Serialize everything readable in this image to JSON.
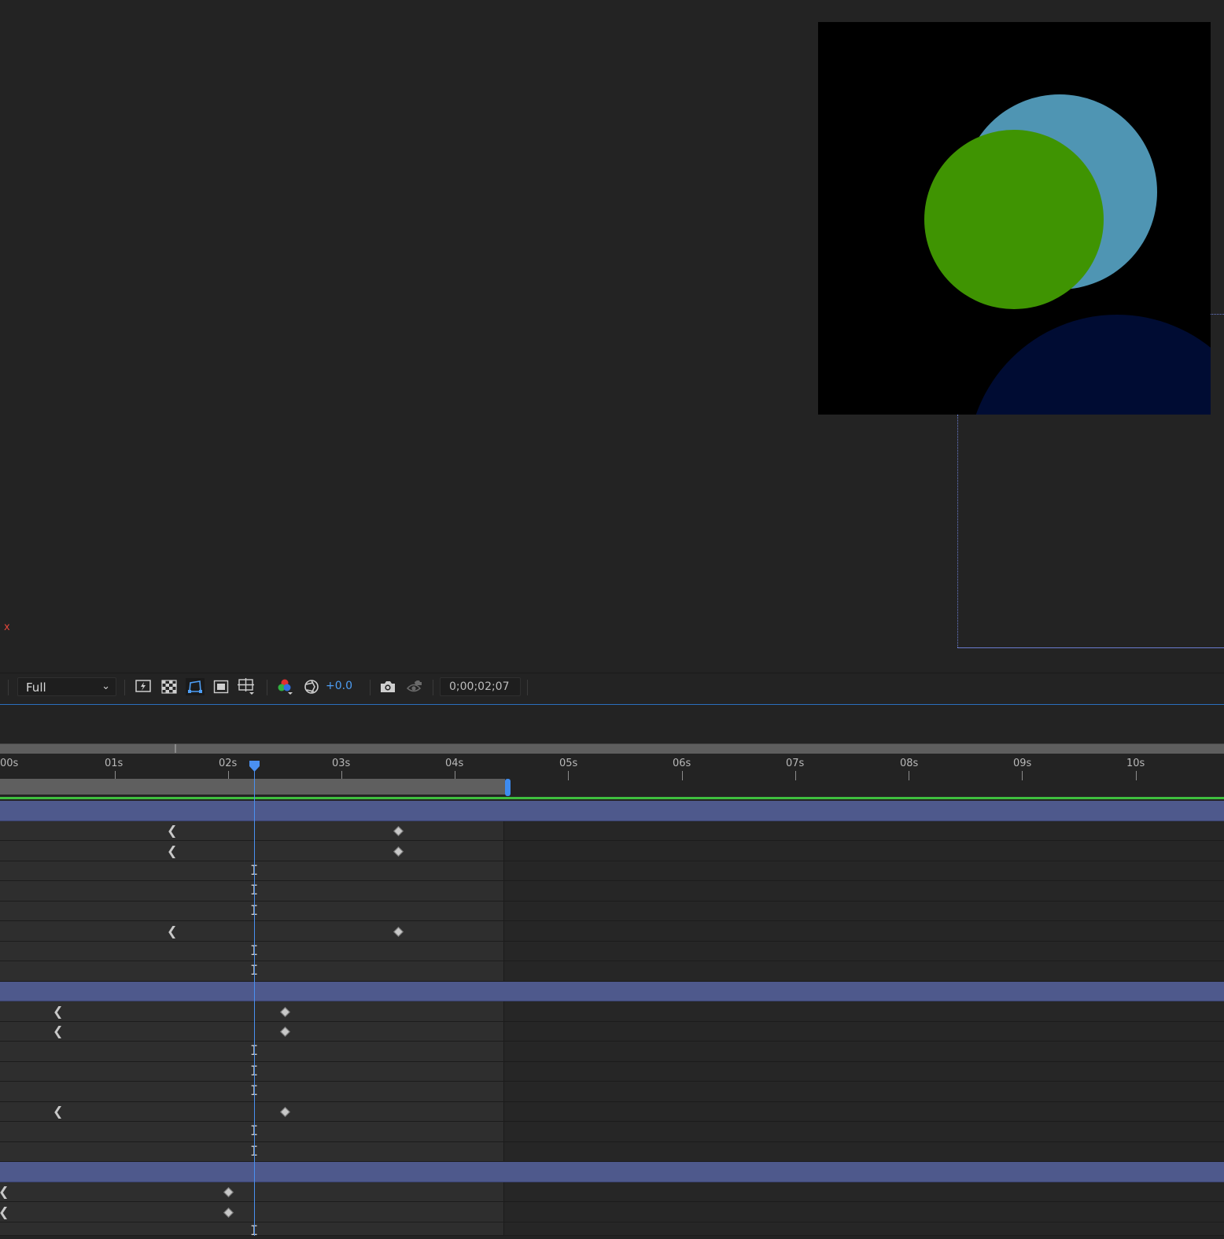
{
  "viewer": {
    "axis_label": "x",
    "colors": {
      "blue_circle": "#4f95b3",
      "green_circle": "#3f9402",
      "navy_circle": "#000c33",
      "accent": "#4d9ef5"
    }
  },
  "toolbar": {
    "resolution": "Full",
    "exposure": "+0.0",
    "timecode": "0;00;02;07",
    "icons": [
      "fast-previews-icon",
      "transparency-grid-icon",
      "mask-path-icon",
      "region-of-interest-icon",
      "grid-guides-icon",
      "color-channels-icon",
      "exposure-reset-icon",
      "snapshot-camera-icon",
      "show-snapshot-icon"
    ]
  },
  "timeline": {
    "ruler_labels": [
      "00s",
      "01s",
      "02s",
      "03s",
      "04s",
      "05s",
      "06s",
      "07s",
      "08s",
      "09s",
      "10s"
    ],
    "current_time_seconds": 2.23,
    "work_area_end_seconds": 4.45
  }
}
